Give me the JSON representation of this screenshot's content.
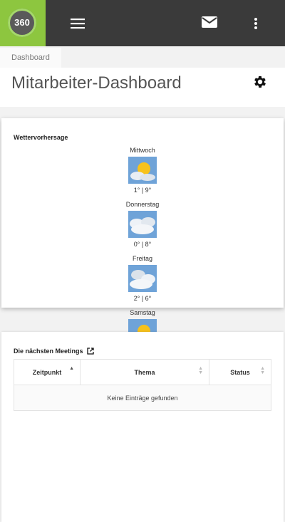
{
  "app": {
    "logo_text": "360"
  },
  "header": {
    "menu_icon": "hamburger-icon",
    "mail_icon": "mail-icon",
    "more_icon": "kebab-icon"
  },
  "breadcrumb": {
    "current": "Dashboard"
  },
  "page": {
    "title": "Mitarbeiter-Dashboard",
    "settings_icon": "gear-icon"
  },
  "weather": {
    "title": "Wettervorhersage",
    "days": [
      {
        "name": "Mittwoch",
        "icon": "sun-behind-cloud-icon",
        "temp": "1° | 9°"
      },
      {
        "name": "Donnerstag",
        "icon": "cloud-icon",
        "temp": "0° | 8°"
      },
      {
        "name": "Freitag",
        "icon": "cloud-icon",
        "temp": "2° | 6°"
      },
      {
        "name": "Samstag",
        "icon": "sun-behind-cloud-icon",
        "temp": ""
      }
    ]
  },
  "meetings": {
    "title": "Die nächsten Meetings",
    "columns": [
      "Zeitpunkt",
      "Thema",
      "Status"
    ],
    "empty_text": "Keine Einträge gefunden"
  },
  "colors": {
    "topbar": "#3a3a3a",
    "logo_bg": "#8dc63f"
  }
}
